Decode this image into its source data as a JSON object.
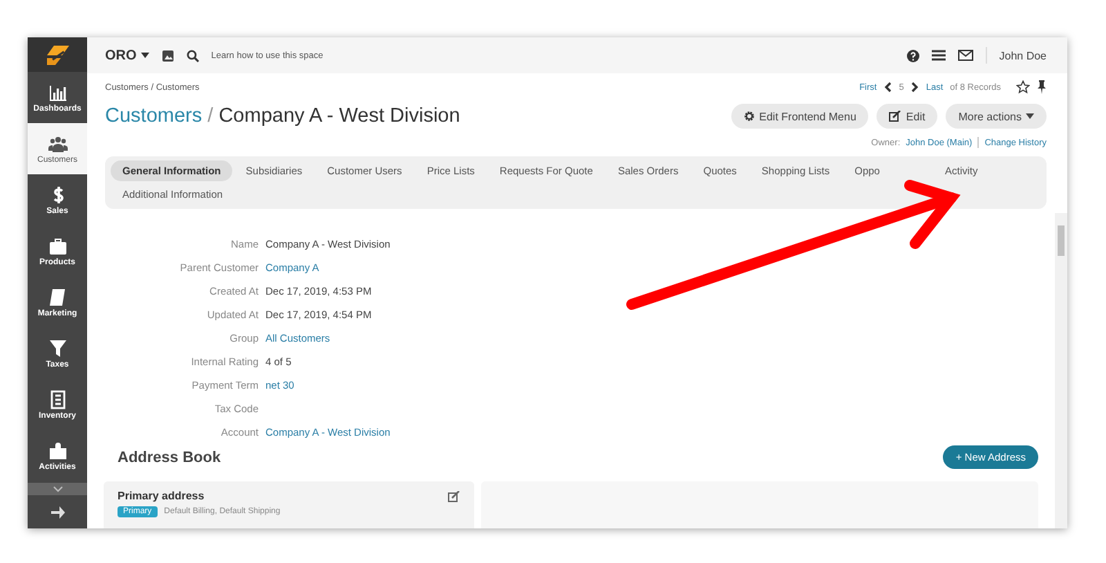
{
  "topbar": {
    "brand": "ORO",
    "hint": "Learn how to use this space",
    "user": "John Doe"
  },
  "sidebar": {
    "items": [
      {
        "label": "Dashboards",
        "selected": false
      },
      {
        "label": "Customers",
        "selected": true
      },
      {
        "label": "Sales",
        "selected": false
      },
      {
        "label": "Products",
        "selected": false
      },
      {
        "label": "Marketing",
        "selected": false
      },
      {
        "label": "Taxes",
        "selected": false
      },
      {
        "label": "Inventory",
        "selected": false
      },
      {
        "label": "Activities",
        "selected": false
      }
    ]
  },
  "breadcrumb": "Customers / Customers",
  "title": {
    "parent": "Customers",
    "separator": "/",
    "name": "Company A - West Division"
  },
  "pager": {
    "first": "First",
    "current": "5",
    "last": "Last",
    "total": "of 8 Records"
  },
  "buttons": [
    {
      "label": "Edit Frontend Menu",
      "kind": "gear"
    },
    {
      "label": "Edit",
      "kind": "edit"
    },
    {
      "label": "More actions",
      "kind": "dropdown"
    }
  ],
  "owner": {
    "label": "Owner:",
    "value": "John Doe (Main)",
    "history": "Change History"
  },
  "tabs": [
    {
      "label": "General Information",
      "selected": true
    },
    {
      "label": "Subsidiaries",
      "selected": false
    },
    {
      "label": "Customer Users",
      "selected": false
    },
    {
      "label": "Price Lists",
      "selected": false
    },
    {
      "label": "Requests For Quote",
      "selected": false
    },
    {
      "label": "Sales Orders",
      "selected": false
    },
    {
      "label": "Quotes",
      "selected": false
    },
    {
      "label": "Shopping Lists",
      "selected": false
    },
    {
      "label": "Oppo",
      "selected": false
    },
    {
      "label": "Activity",
      "selected": false
    },
    {
      "label": "Additional Information",
      "selected": false
    }
  ],
  "fields": [
    {
      "label": "Name",
      "value": "Company A - West Division",
      "link": false
    },
    {
      "label": "Parent Customer",
      "value": "Company A",
      "link": true
    },
    {
      "label": "Created At",
      "value": "Dec 17, 2019, 4:53 PM",
      "link": false
    },
    {
      "label": "Updated At",
      "value": "Dec 17, 2019, 4:54 PM",
      "link": false
    },
    {
      "label": "Group",
      "value": "All Customers",
      "link": true
    },
    {
      "label": "Internal Rating",
      "value": "4 of 5",
      "link": false
    },
    {
      "label": "Payment Term",
      "value": "net 30",
      "link": true
    },
    {
      "label": "Tax Code"
    },
    {
      "label": "Account",
      "value": "Company A - West Division",
      "link": true
    }
  ],
  "address_book": {
    "title": "Address Book",
    "new_button": "+ New Address",
    "card": {
      "title": "Primary address",
      "badge": "Primary",
      "types": "Default Billing, Default Shipping"
    }
  }
}
